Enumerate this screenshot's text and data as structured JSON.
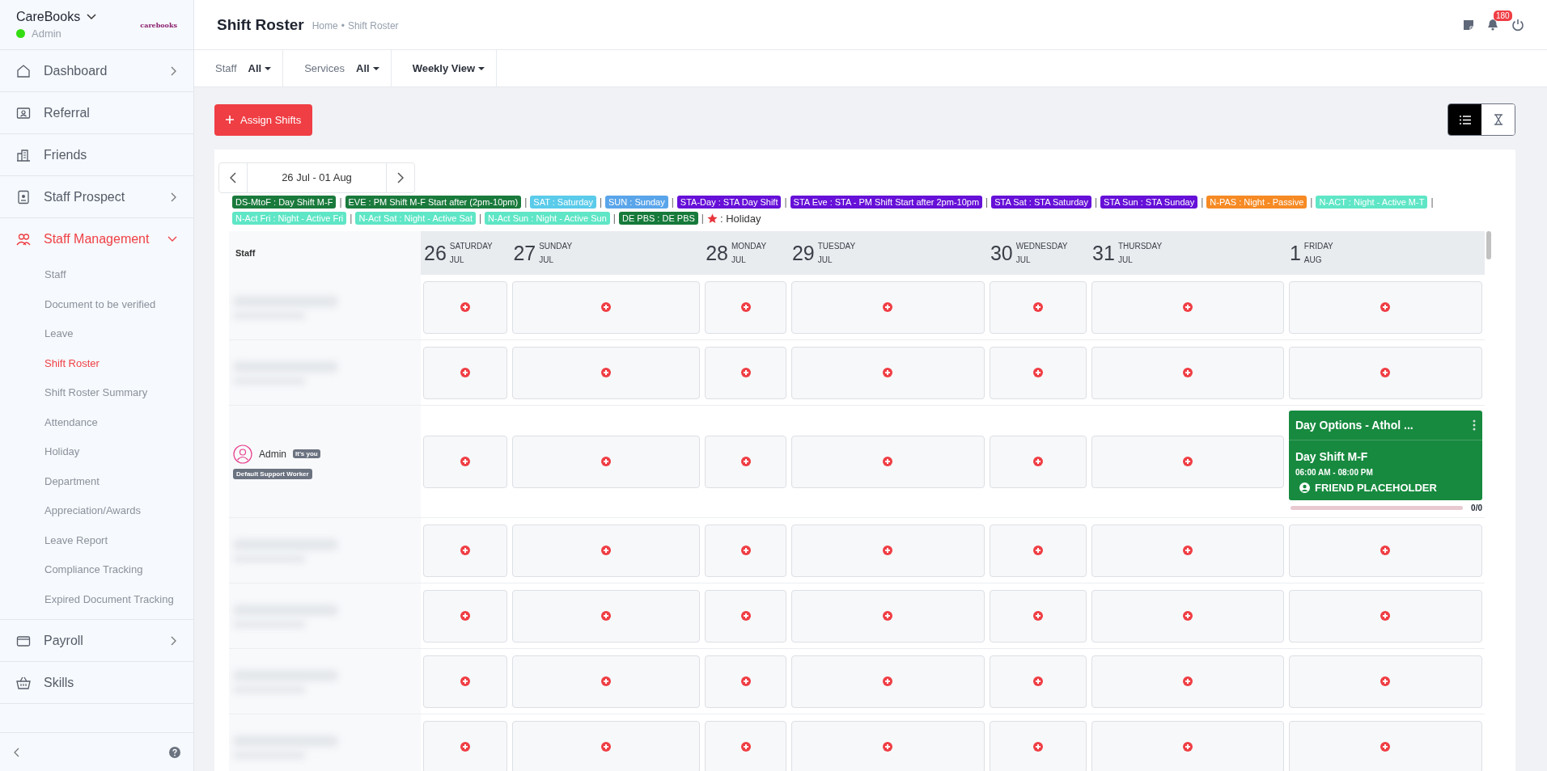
{
  "sidebar": {
    "brand": "CareBooks",
    "role": "Admin",
    "online": true,
    "logo": "carebooks",
    "items": [
      {
        "kind": "home",
        "label": "Dashboard",
        "expandable": true,
        "expanded": false,
        "selected": false
      },
      {
        "kind": "idcard",
        "label": "Referral",
        "expandable": false,
        "expanded": false,
        "selected": false
      },
      {
        "kind": "building",
        "label": "Friends",
        "expandable": false,
        "expanded": false,
        "selected": false
      },
      {
        "kind": "badge",
        "label": "Staff Prospect",
        "expandable": true,
        "expanded": false,
        "selected": false
      },
      {
        "kind": "users",
        "label": "Staff Management",
        "expandable": true,
        "expanded": true,
        "selected": true,
        "children": [
          {
            "label": "Staff",
            "selected": false
          },
          {
            "label": "Document to be verified",
            "selected": false
          },
          {
            "label": "Leave",
            "selected": false
          },
          {
            "label": "Shift Roster",
            "selected": true
          },
          {
            "label": "Shift Roster Summary",
            "selected": false
          },
          {
            "label": "Attendance",
            "selected": false
          },
          {
            "label": "Holiday",
            "selected": false
          },
          {
            "label": "Department",
            "selected": false
          },
          {
            "label": "Appreciation/Awards",
            "selected": false
          },
          {
            "label": "Leave Report",
            "selected": false
          },
          {
            "label": "Compliance Tracking",
            "selected": false
          },
          {
            "label": "Expired Document Tracking",
            "selected": false
          }
        ]
      },
      {
        "kind": "wallet",
        "label": "Payroll",
        "expandable": true,
        "expanded": false,
        "selected": false
      },
      {
        "kind": "basket",
        "label": "Skills",
        "expandable": false,
        "expanded": false,
        "selected": false
      }
    ]
  },
  "header": {
    "title": "Shift Roster",
    "breadcrumb": [
      "Home",
      "Shift Roster"
    ],
    "separator": "•",
    "notifications": "180"
  },
  "filters": [
    {
      "label": "Staff",
      "value": "All"
    },
    {
      "label": "Services",
      "value": "All"
    },
    {
      "value": "Weekly View"
    }
  ],
  "assign_button": "Assign Shifts",
  "view_toggle": [
    {
      "kind": "list",
      "selected": true
    },
    {
      "kind": "hourglass",
      "selected": false
    }
  ],
  "date_range": "26 Jul - 01 Aug",
  "legend": [
    {
      "text": "DS-MtoF : Day Shift M-F",
      "color": "#1a7a3c"
    },
    {
      "text": "EVE : PM Shift M-F Start after (2pm-10pm)",
      "color": "#1a7a3c"
    },
    {
      "text": "SAT : Saturday",
      "color": "#5bcbea"
    },
    {
      "text": "SUN : Sunday",
      "color": "#5aa5ea"
    },
    {
      "text": "STA-Day : STA Day Shift",
      "color": "#6610d8"
    },
    {
      "text": "STA Eve : STA - PM Shift Start after 2pm-10pm",
      "color": "#6610d8"
    },
    {
      "text": "STA Sat : STA Saturday",
      "color": "#6610d8"
    },
    {
      "text": "STA Sun : STA Sunday",
      "color": "#6610d8"
    },
    {
      "text": "N-PAS : Night - Passive",
      "color": "#f68a24"
    },
    {
      "text": "N-ACT : Night - Active M-T",
      "color": "#5fe6c6"
    },
    {
      "text": "N-Act Fri : Night - Active Fri",
      "color": "#5fe6c6"
    },
    {
      "text": "N-Act Sat : Night - Active Sat",
      "color": "#5fe6c6"
    },
    {
      "text": "N-Act Sun : Night - Active Sun",
      "color": "#5fe6c6"
    },
    {
      "text": "DE PBS : DE PBS",
      "color": "#167a3a"
    }
  ],
  "legend_separator": "|",
  "holiday_legend": ": Holiday",
  "calendar": {
    "staff_header": "Staff",
    "days": [
      {
        "date": "26",
        "weekday": "SATURDAY",
        "month": "JUL"
      },
      {
        "date": "27",
        "weekday": "SUNDAY",
        "month": "JUL"
      },
      {
        "date": "28",
        "weekday": "MONDAY",
        "month": "JUL"
      },
      {
        "date": "29",
        "weekday": "TUESDAY",
        "month": "JUL"
      },
      {
        "date": "30",
        "weekday": "WEDNESDAY",
        "month": "JUL"
      },
      {
        "date": "31",
        "weekday": "THURSDAY",
        "month": "JUL"
      },
      {
        "date": "1",
        "weekday": "FRIDAY",
        "month": "AUG"
      }
    ],
    "rows": [
      {
        "kind": "blurred",
        "cells": [
          {
            "kind": "add"
          },
          {
            "kind": "add"
          },
          {
            "kind": "add"
          },
          {
            "kind": "add"
          },
          {
            "kind": "add"
          },
          {
            "kind": "add"
          },
          {
            "kind": "add"
          }
        ]
      },
      {
        "kind": "blurred",
        "cells": [
          {
            "kind": "add"
          },
          {
            "kind": "add"
          },
          {
            "kind": "add"
          },
          {
            "kind": "add"
          },
          {
            "kind": "add"
          },
          {
            "kind": "add"
          },
          {
            "kind": "add"
          }
        ]
      },
      {
        "kind": "user",
        "name": "Admin",
        "tag": "It's you",
        "role": "Default Support Worker",
        "cells": [
          {
            "kind": "add"
          },
          {
            "kind": "add"
          },
          {
            "kind": "add"
          },
          {
            "kind": "add"
          },
          {
            "kind": "add"
          },
          {
            "kind": "add"
          },
          {
            "kind": "shift",
            "title": "Day Options - Athol ...",
            "shift": "Day Shift M-F",
            "time": "06:00 AM - 08:00 PM",
            "friend": "FRIEND PLACEHOLDER",
            "color": "#178a3f",
            "level": 0,
            "count": "0/0"
          }
        ]
      },
      {
        "kind": "blurred",
        "cells": [
          {
            "kind": "add"
          },
          {
            "kind": "add"
          },
          {
            "kind": "add"
          },
          {
            "kind": "add"
          },
          {
            "kind": "add"
          },
          {
            "kind": "add"
          },
          {
            "kind": "add"
          }
        ]
      },
      {
        "kind": "blurred",
        "cells": [
          {
            "kind": "add"
          },
          {
            "kind": "add"
          },
          {
            "kind": "add"
          },
          {
            "kind": "add"
          },
          {
            "kind": "add"
          },
          {
            "kind": "add"
          },
          {
            "kind": "add"
          }
        ]
      },
      {
        "kind": "blurred",
        "cells": [
          {
            "kind": "add"
          },
          {
            "kind": "add"
          },
          {
            "kind": "add"
          },
          {
            "kind": "add"
          },
          {
            "kind": "add"
          },
          {
            "kind": "add"
          },
          {
            "kind": "add"
          }
        ]
      },
      {
        "kind": "blurred",
        "cells": [
          {
            "kind": "add"
          },
          {
            "kind": "add"
          },
          {
            "kind": "add"
          },
          {
            "kind": "add"
          },
          {
            "kind": "add"
          },
          {
            "kind": "add"
          },
          {
            "kind": "add"
          }
        ]
      }
    ]
  }
}
